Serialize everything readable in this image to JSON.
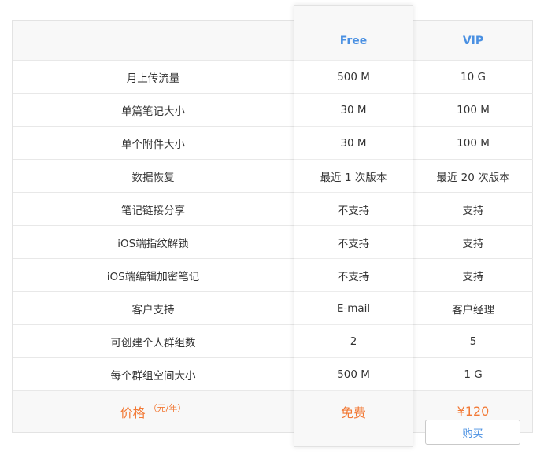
{
  "header": {
    "free_label": "Free",
    "vip_label": "VIP"
  },
  "rows": [
    {
      "feature": "月上传流量",
      "free": "500 M",
      "vip": "10 G"
    },
    {
      "feature": "单篇笔记大小",
      "free": "30 M",
      "vip": "100 M"
    },
    {
      "feature": "单个附件大小",
      "free": "30 M",
      "vip": "100 M"
    },
    {
      "feature": "数据恢复",
      "free": "最近 1 次版本",
      "vip": "最近 20 次版本"
    },
    {
      "feature": "笔记链接分享",
      "free": "不支持",
      "vip": "支持"
    },
    {
      "feature": "iOS端指纹解锁",
      "free": "不支持",
      "vip": "支持"
    },
    {
      "feature": "iOS端编辑加密笔记",
      "free": "不支持",
      "vip": "支持"
    },
    {
      "feature": "客户支持",
      "free": "E-mail",
      "vip": "客户经理"
    },
    {
      "feature": "可创建个人群组数",
      "free": "2",
      "vip": "5"
    },
    {
      "feature": "每个群组空间大小",
      "free": "500 M",
      "vip": "1 G"
    }
  ],
  "price_row": {
    "label": "价格",
    "unit": "（元/年）",
    "free": "免费",
    "vip": "¥120"
  },
  "buy_button": "购买",
  "colors": {
    "accent_blue": "#4a90e2",
    "price_orange": "#f27935",
    "band_gray": "#f8f8f8"
  }
}
